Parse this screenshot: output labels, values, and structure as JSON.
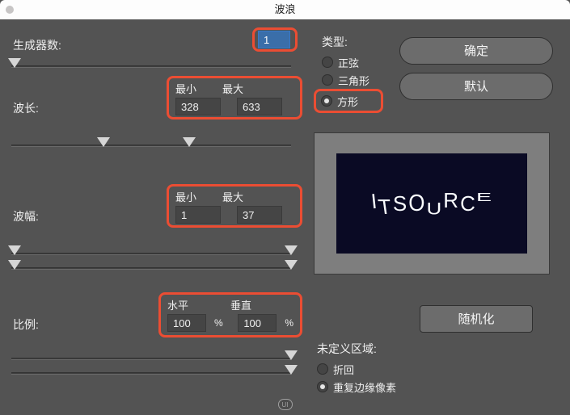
{
  "title": "波浪",
  "generators": {
    "label": "生成器数:",
    "value": "1"
  },
  "wavelength": {
    "label": "波长:",
    "minLabel": "最小",
    "maxLabel": "最大",
    "min": "328",
    "max": "633"
  },
  "amplitude": {
    "label": "波幅:",
    "minLabel": "最小",
    "maxLabel": "最大",
    "min": "1",
    "max": "37"
  },
  "scale": {
    "label": "比例:",
    "hLabel": "水平",
    "vLabel": "垂直",
    "h": "100",
    "v": "100"
  },
  "type": {
    "label": "类型:",
    "options": [
      {
        "label": "正弦",
        "checked": false
      },
      {
        "label": "三角形",
        "checked": false
      },
      {
        "label": "方形",
        "checked": true
      }
    ]
  },
  "buttons": {
    "ok": "确定",
    "default": "默认",
    "randomize": "随机化"
  },
  "undefinedAreas": {
    "label": "未定义区域:",
    "options": [
      {
        "label": "折回",
        "checked": false
      },
      {
        "label": "重复边缘像素",
        "checked": true
      }
    ]
  },
  "previewText": "ITSOURCE",
  "percent": "%",
  "watermark": "UI"
}
